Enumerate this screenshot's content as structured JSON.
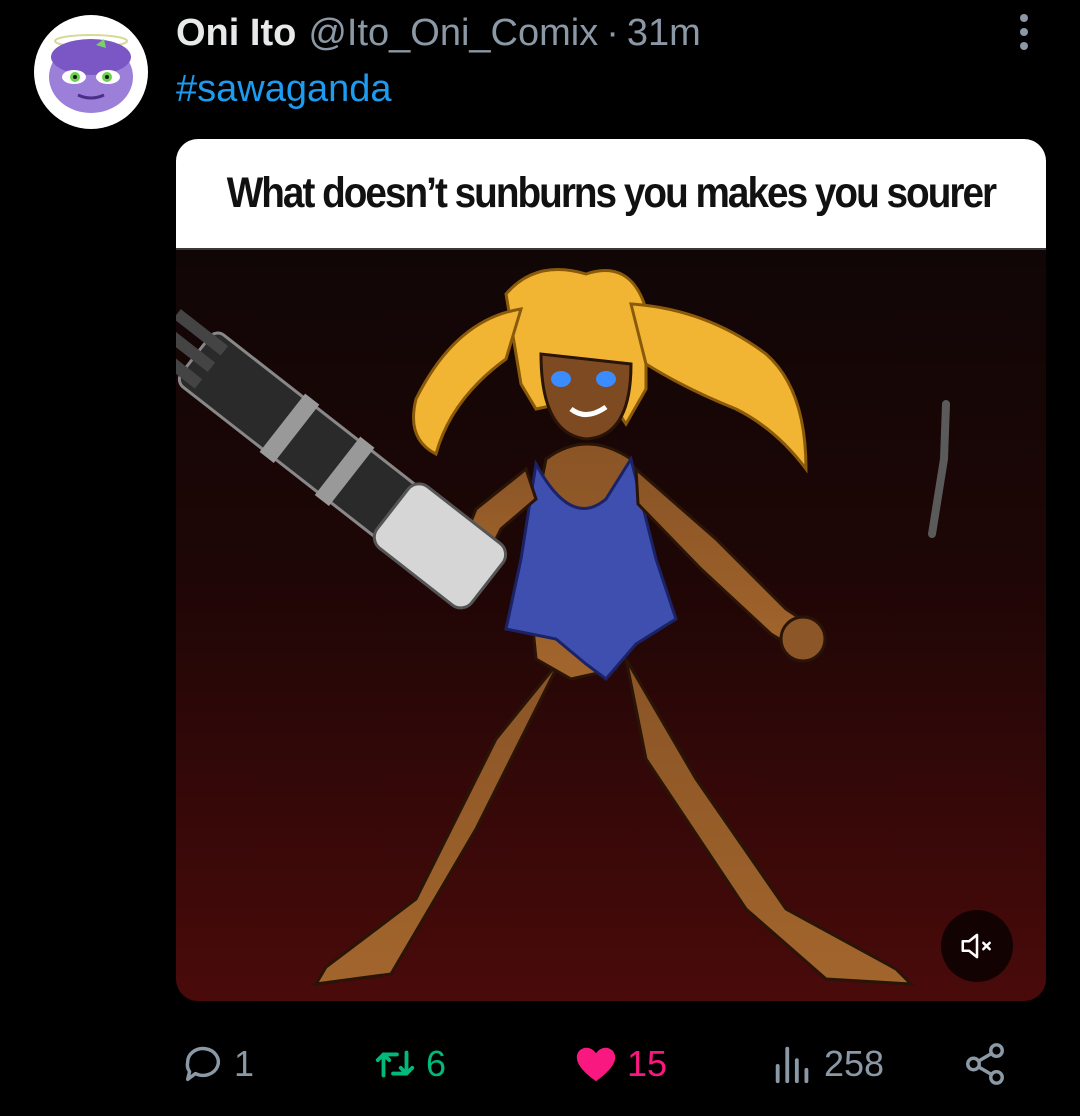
{
  "post": {
    "author": {
      "display_name": "Oni Ito",
      "handle": "@Ito_Oni_Comix",
      "separator": "·",
      "time_ago": "31m",
      "avatar": "purple-cartoon-character-avatar"
    },
    "text": "#sawaganda",
    "media": {
      "caption": "What doesn’t sunburns you makes you sourer",
      "content": "cartoon-girl-with-minigun-image",
      "mute_icon": "volume-muted-icon"
    },
    "more_icon": "more-vertical-icon"
  },
  "actions": {
    "reply": {
      "icon": "reply-bubble-icon",
      "count": "1"
    },
    "repost": {
      "icon": "repost-icon",
      "count": "6"
    },
    "like": {
      "icon": "heart-filled-icon",
      "count": "15"
    },
    "views": {
      "icon": "views-bar-chart-icon",
      "count": "258"
    },
    "share": {
      "icon": "share-icon"
    }
  },
  "colors": {
    "background": "#000000",
    "primary_text": "#e7e9ea",
    "secondary_text": "#8b98a5",
    "link": "#1d9bf0",
    "repost_active": "#00ba7c",
    "like_active": "#f91880"
  }
}
